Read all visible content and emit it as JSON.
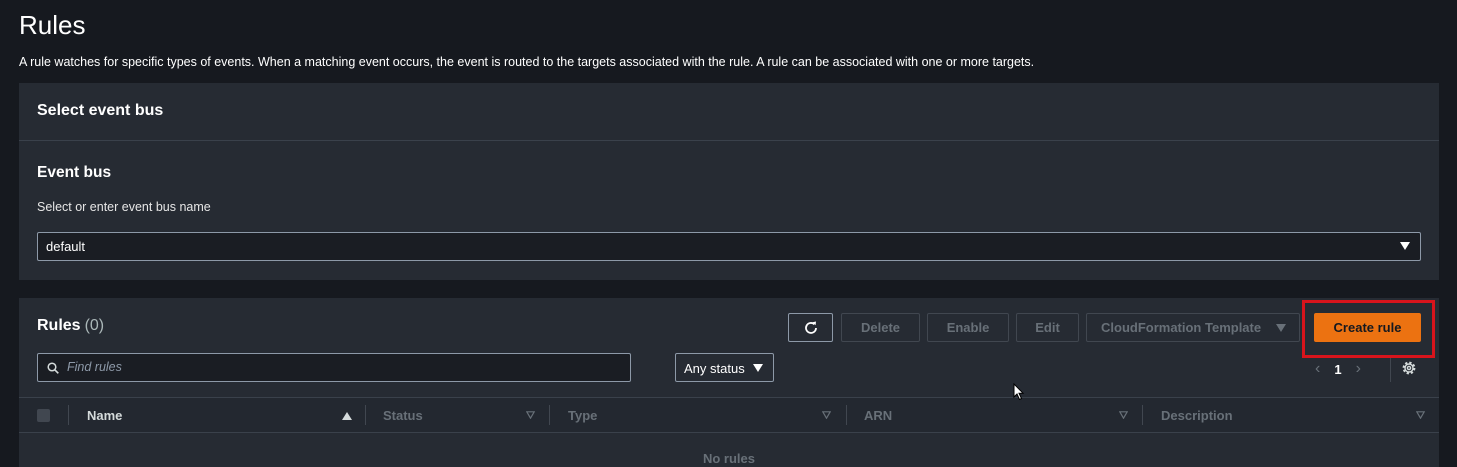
{
  "page": {
    "title": "Rules",
    "description": "A rule watches for specific types of events. When a matching event occurs, the event is routed to the targets associated with the rule. A rule can be associated with one or more targets."
  },
  "event_bus_panel": {
    "header": "Select event bus",
    "label": "Event bus",
    "sublabel": "Select or enter event bus name",
    "selected_value": "default"
  },
  "rules_panel": {
    "title": "Rules",
    "count": "(0)",
    "buttons": {
      "delete": "Delete",
      "enable": "Enable",
      "edit": "Edit",
      "cloudformation": "CloudFormation Template",
      "create": "Create rule"
    },
    "search_placeholder": "Find rules",
    "status_filter": "Any status",
    "page_number": "1",
    "columns": [
      "Name",
      "Status",
      "Type",
      "ARN",
      "Description"
    ],
    "empty_text": "No rules"
  },
  "colors": {
    "accent": "#ec7211",
    "highlight": "#d8141c",
    "background": "#16191f",
    "panel": "#262b33"
  }
}
